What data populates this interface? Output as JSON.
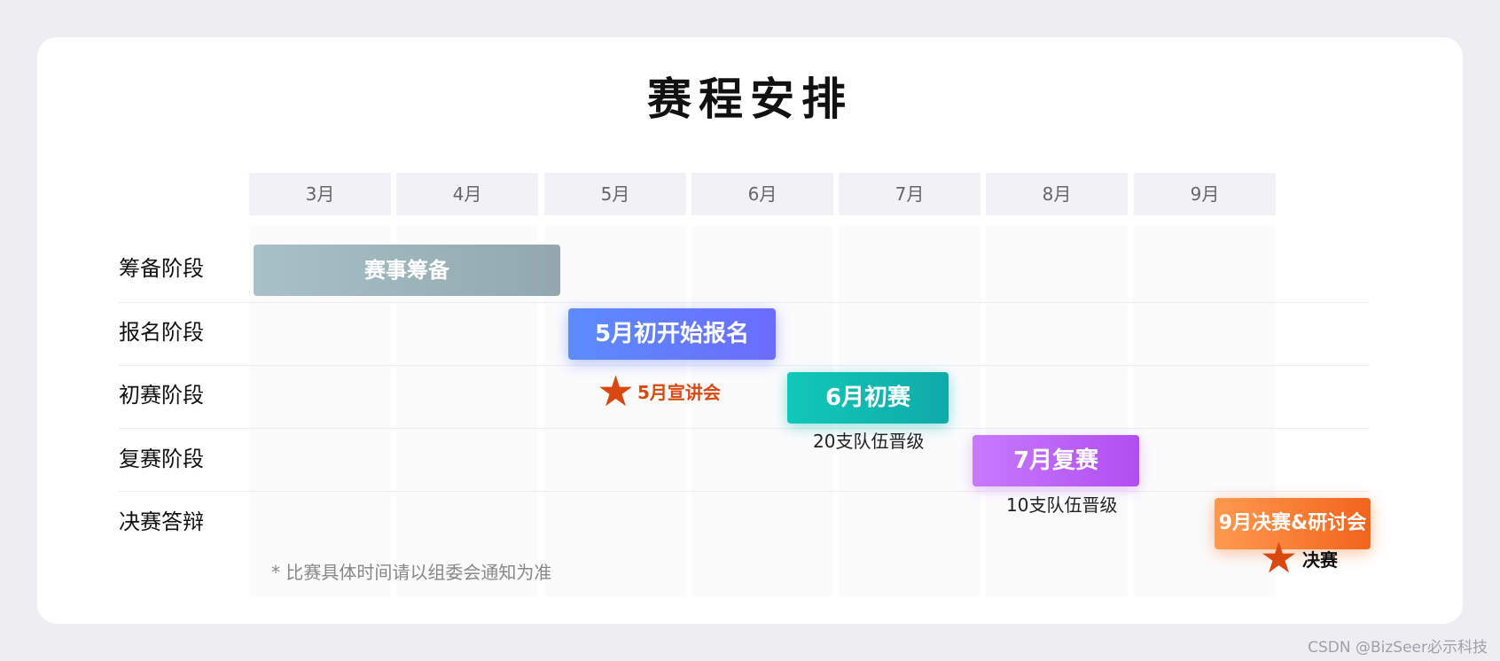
{
  "title": "赛程安排",
  "months": [
    "3月",
    "4月",
    "5月",
    "6月",
    "7月",
    "8月",
    "9月"
  ],
  "rows": [
    "筹备阶段",
    "报名阶段",
    "初赛阶段",
    "复赛阶段",
    "决赛答辩"
  ],
  "bars": {
    "prep": "赛事筹备",
    "registration": "5月初开始报名",
    "preliminary": "6月初赛",
    "semifinal": "7月复赛",
    "final": "9月决赛&研讨会"
  },
  "milestones": {
    "briefing": "5月宣讲会",
    "final": "决赛"
  },
  "notes": {
    "preliminary_advance": "20支队伍晋级",
    "semifinal_advance": "10支队伍晋级"
  },
  "footnote": "* 比赛具体时间请以组委会通知为准",
  "watermark": "CSDN @BizSeer必示科技",
  "colors": {
    "milestone_star": "#d9480f",
    "briefing_label": "#d9480f",
    "prep_bar": "#9fb6bd",
    "registration_bar": "#6479ff",
    "preliminary_bar": "#10bab0",
    "semifinal_bar": "#bd63f5",
    "final_bar": "#f77f36"
  }
}
